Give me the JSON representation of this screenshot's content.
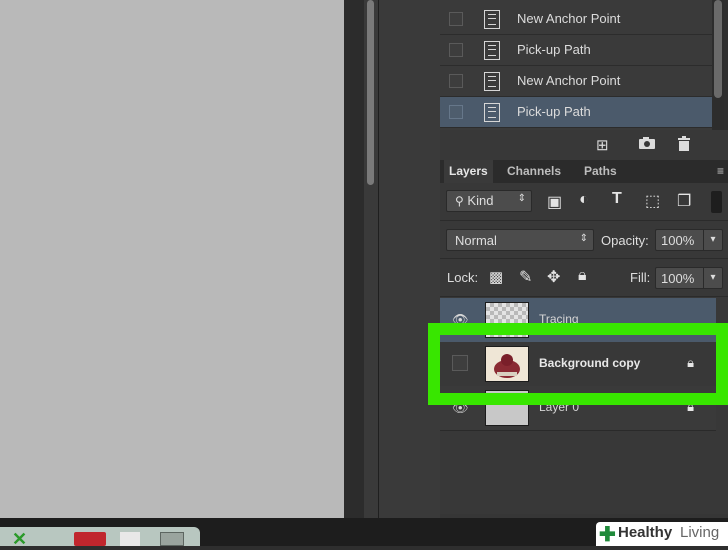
{
  "history": {
    "items": [
      {
        "label": "New Anchor Point",
        "selected": false
      },
      {
        "label": "Pick-up Path",
        "selected": false
      },
      {
        "label": "New Anchor Point",
        "selected": false
      },
      {
        "label": "Pick-up Path",
        "selected": true
      }
    ]
  },
  "layers_panel": {
    "tabs": [
      "Layers",
      "Channels",
      "Paths"
    ],
    "filter_kind": "Kind",
    "blend_mode": "Normal",
    "opacity_label": "Opacity:",
    "opacity_value": "100%",
    "lock_label": "Lock:",
    "fill_label": "Fill:",
    "fill_value": "100%",
    "layers": [
      {
        "name": "Tracing",
        "visible": true,
        "locked": false
      },
      {
        "name": "Background copy",
        "visible": false,
        "locked": true,
        "highlighted": true
      },
      {
        "name": "Layer 0",
        "visible": true,
        "locked": true
      }
    ]
  },
  "watermark": {
    "brand_a": "Healthy",
    "brand_b": "Living"
  },
  "colors": {
    "highlight": "#38e600",
    "selected_row": "#4b5a6b"
  }
}
